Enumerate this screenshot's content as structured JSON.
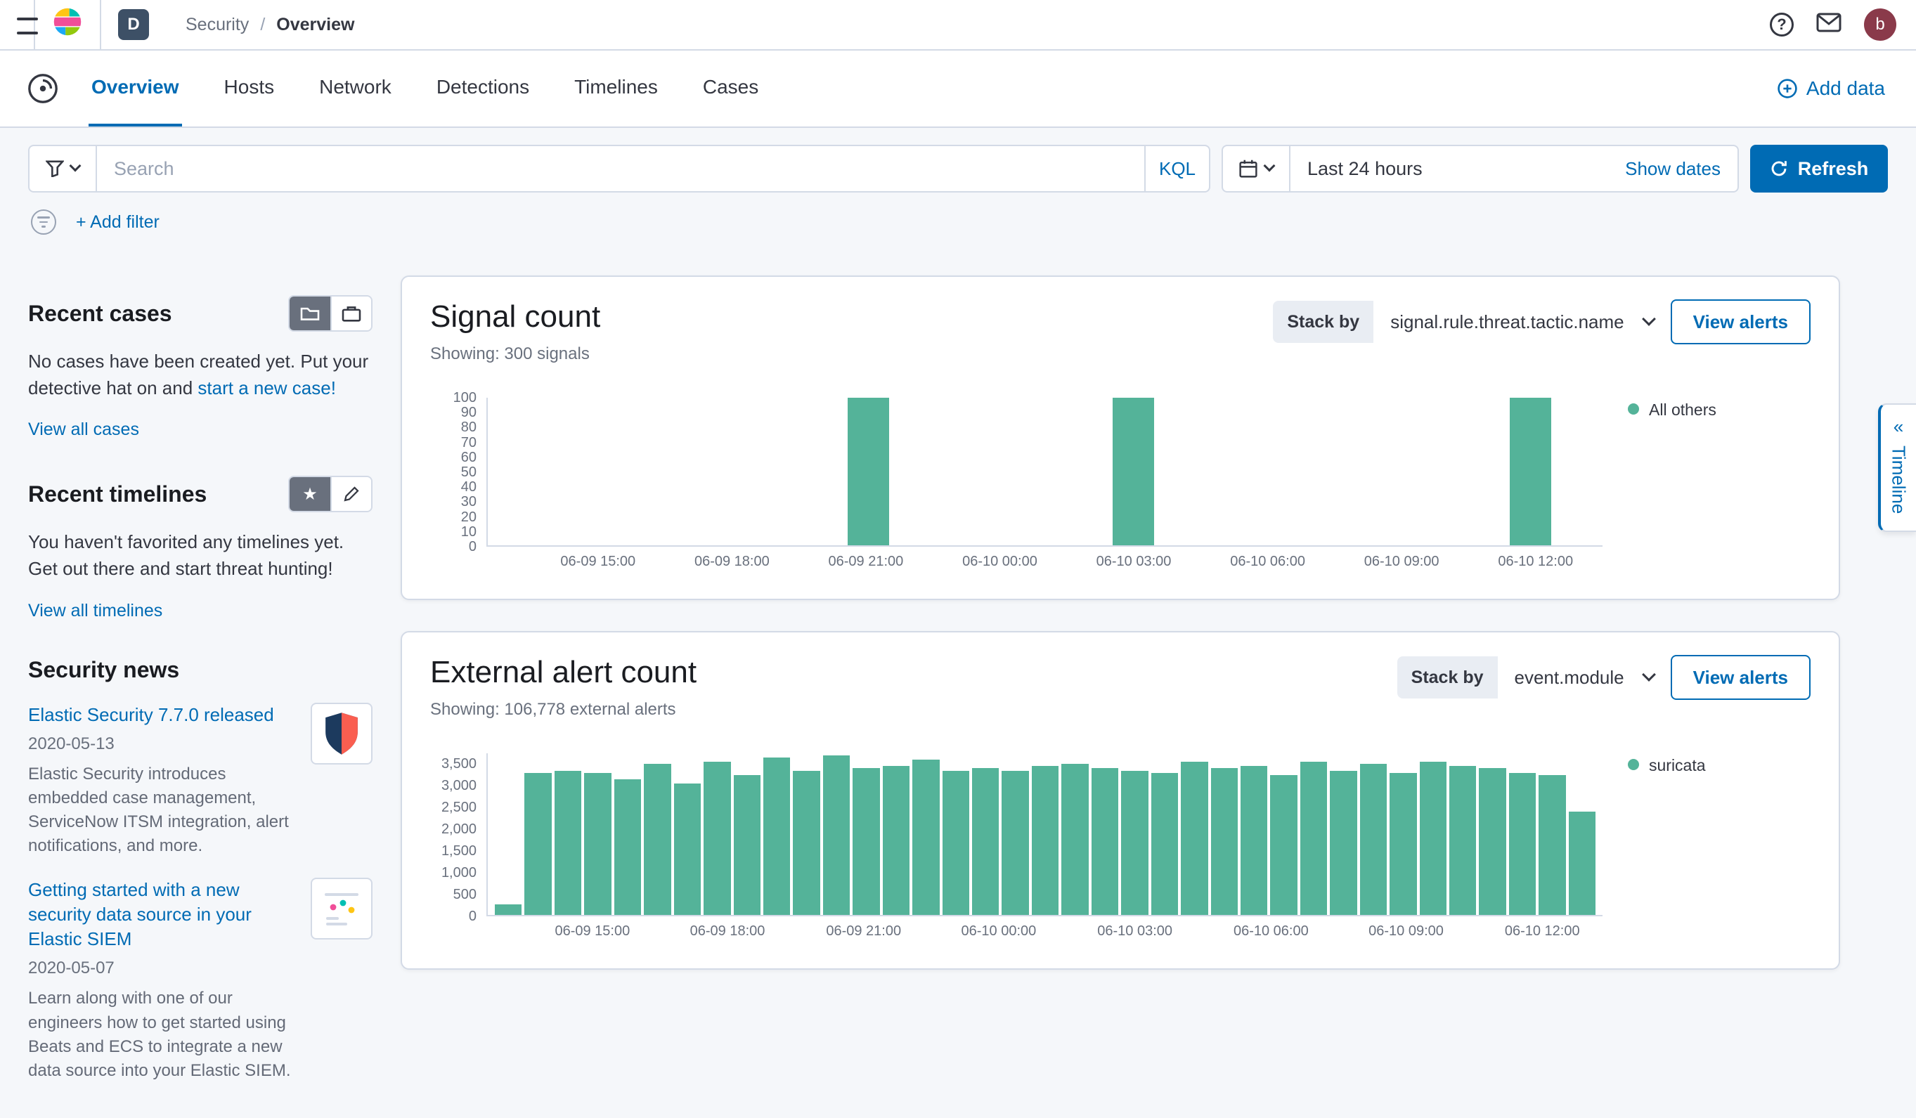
{
  "colors": {
    "accent": "#006BB4",
    "bar_teal": "#54B399",
    "avatar_bg": "#8a3a4a",
    "space_badge_bg": "#3d5066"
  },
  "icons": {
    "chevron_double_left": "«",
    "star": "★",
    "help": "?"
  },
  "header": {
    "breadcrumb_items": [
      "Security",
      "Overview"
    ],
    "breadcrumb_separator": "/",
    "space_initial": "D",
    "user_initial": "b"
  },
  "nav": {
    "tabs": [
      {
        "label": "Overview"
      },
      {
        "label": "Hosts"
      },
      {
        "label": "Network"
      },
      {
        "label": "Detections"
      },
      {
        "label": "Timelines"
      },
      {
        "label": "Cases"
      }
    ],
    "active_tab": "Overview",
    "add_data": "Add data"
  },
  "query_bar": {
    "search_placeholder": "Search",
    "kql": "KQL",
    "time_range": "Last 24 hours",
    "show_dates": "Show dates",
    "refresh": "Refresh",
    "add_filter": "+ Add filter"
  },
  "sidebar": {
    "recent_cases": {
      "title": "Recent cases",
      "empty_prefix": "No cases have been created yet. Put your detective hat on and ",
      "empty_link": "start a new case!",
      "view_all": "View all cases"
    },
    "recent_timelines": {
      "title": "Recent timelines",
      "empty": "You haven't favorited any timelines yet. Get out there and start threat hunting!",
      "view_all": "View all timelines"
    },
    "news": {
      "title": "Security news",
      "items": [
        {
          "title": "Elastic Security 7.7.0 released",
          "date": "2020-05-13",
          "summary": "Elastic Security introduces embedded case management, ServiceNow ITSM integration, alert notifications, and more."
        },
        {
          "title": "Getting started with a new security data source in your Elastic SIEM",
          "date": "2020-05-07",
          "summary": "Learn along with one of our engineers how to get started using Beats and ECS to integrate a new data source into your Elastic SIEM."
        }
      ]
    }
  },
  "timeline": {
    "label": "Timeline"
  },
  "chart_data": [
    {
      "type": "bar",
      "title": "Signal count",
      "subtitle": "Showing: 300 signals",
      "stack_by_label": "Stack by",
      "stack_by_value": "signal.rule.threat.tactic.name",
      "view_alerts": "View alerts",
      "legend": [
        "All others"
      ],
      "legend_position": "right",
      "bar_color": "#54B399",
      "grid": false,
      "ymax": 100,
      "ylim": [
        0,
        100
      ],
      "ytick_values": [
        0,
        10,
        20,
        30,
        40,
        50,
        60,
        70,
        80,
        90,
        100
      ],
      "ytick_labels": [
        "0",
        "10",
        "20",
        "30",
        "40",
        "50",
        "60",
        "70",
        "80",
        "90",
        "100"
      ],
      "x_tick_labels": [
        "06-09 15:00",
        "06-09 18:00",
        "06-09 21:00",
        "06-10 00:00",
        "06-10 03:00",
        "06-10 06:00",
        "06-10 09:00",
        "06-10 12:00"
      ],
      "x_tick_fractions": [
        0.1,
        0.22,
        0.34,
        0.46,
        0.58,
        0.7,
        0.82,
        0.94
      ],
      "values": [
        0,
        0,
        0,
        0,
        0,
        0,
        0,
        0,
        100,
        0,
        0,
        0,
        0,
        0,
        100,
        0,
        0,
        0,
        0,
        0,
        0,
        0,
        0,
        100,
        0
      ]
    },
    {
      "type": "bar",
      "title": "External alert count",
      "subtitle": "Showing: 106,778 external alerts",
      "stack_by_label": "Stack by",
      "stack_by_value": "event.module",
      "view_alerts": "View alerts",
      "legend": [
        "suricata"
      ],
      "legend_position": "right",
      "bar_color": "#54B399",
      "grid": false,
      "ymax": 3750,
      "ylim": [
        0,
        3500
      ],
      "ytick_values": [
        0,
        500,
        1000,
        1500,
        2000,
        2500,
        3000,
        3500
      ],
      "ytick_labels": [
        "0",
        "500",
        "1,000",
        "1,500",
        "2,000",
        "2,500",
        "3,000",
        "3,500"
      ],
      "x_tick_labels": [
        "06-09 15:00",
        "06-09 18:00",
        "06-09 21:00",
        "06-10 00:00",
        "06-10 03:00",
        "06-10 06:00",
        "06-10 09:00",
        "06-10 12:00"
      ],
      "x_tick_fractions": [
        0.095,
        0.216,
        0.338,
        0.459,
        0.581,
        0.703,
        0.824,
        0.946
      ],
      "values": [
        250,
        3300,
        3350,
        3300,
        3150,
        3500,
        3050,
        3550,
        3250,
        3650,
        3350,
        3700,
        3400,
        3450,
        3600,
        3350,
        3400,
        3350,
        3450,
        3500,
        3400,
        3350,
        3300,
        3550,
        3400,
        3450,
        3250,
        3550,
        3350,
        3500,
        3300,
        3550,
        3450,
        3400,
        3300,
        3250,
        2400
      ]
    }
  ]
}
